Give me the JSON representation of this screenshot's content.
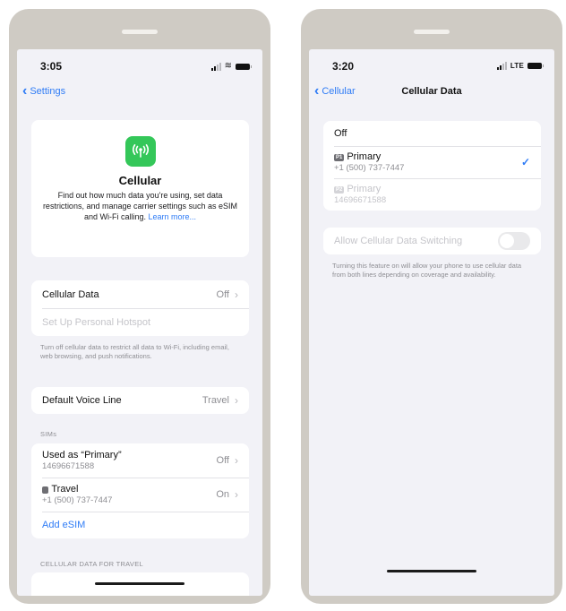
{
  "left": {
    "time": "3:05",
    "back_label": "Settings",
    "hero": {
      "title": "Cellular",
      "description": "Find out how much data you're using, set data restrictions, and manage carrier settings such as eSIM and Wi-Fi calling.",
      "learn_more": "Learn more..."
    },
    "cellular_data": {
      "label": "Cellular Data",
      "value": "Off"
    },
    "hotspot": {
      "label": "Set Up Personal Hotspot"
    },
    "cellular_footnote": "Turn off cellular data to restrict all data to Wi-Fi, including email, web browsing, and push notifications.",
    "default_voice": {
      "label": "Default Voice Line",
      "value": "Travel"
    },
    "sims_header": "SIMs",
    "sims": [
      {
        "label": "Used as “Primary”",
        "sub": "14696671588",
        "value": "Off"
      },
      {
        "label": "Travel",
        "sub": "+1 (500) 737-7447",
        "value": "On"
      }
    ],
    "add_esim": "Add eSIM",
    "data_for_travel_header": "CELLULAR DATA FOR TRAVEL"
  },
  "right": {
    "time": "3:20",
    "network": "LTE",
    "back_label": "Cellular",
    "title": "Cellular Data",
    "options": {
      "off": "Off",
      "primary": {
        "badge": "P1",
        "label": "Primary",
        "sub": "+1 (500) 737-7447"
      },
      "primary_disabled": {
        "badge": "P2",
        "label": "Primary",
        "sub": "14696671588"
      }
    },
    "switching_label": "Allow Cellular Data Switching",
    "switching_footnote": "Turning this feature on will allow your phone to use cellular data from both lines depending on coverage and availability."
  },
  "colors": {
    "accent": "#2f7cf6",
    "cellular_icon": "#34c759",
    "frame": "#cfcbc4"
  }
}
